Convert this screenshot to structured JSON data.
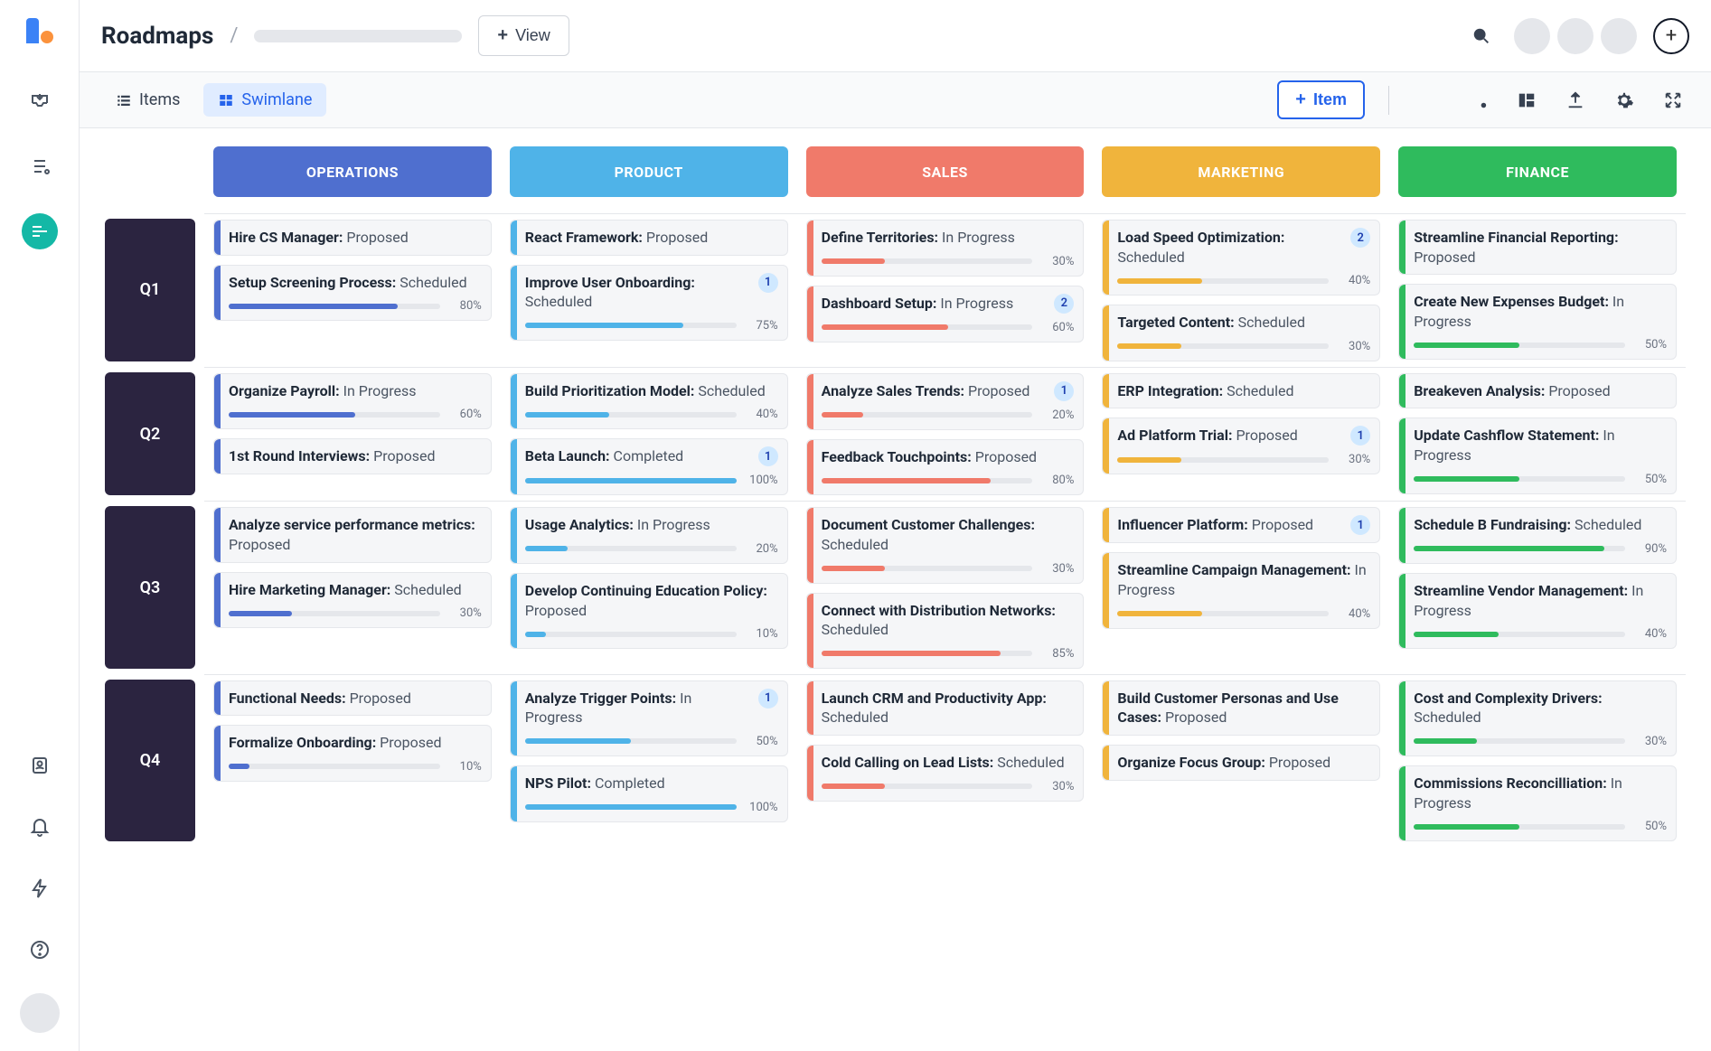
{
  "page_title": "Roadmaps",
  "topbar": {
    "view_button": "View"
  },
  "tabs": {
    "items": "Items",
    "swimlane": "Swimlane"
  },
  "toolbar": {
    "add_item": "Item"
  },
  "columns": [
    {
      "label": "OPERATIONS",
      "color": "#4f6fcf"
    },
    {
      "label": "PRODUCT",
      "color": "#4fb3e8"
    },
    {
      "label": "SALES",
      "color": "#f07a6a"
    },
    {
      "label": "MARKETING",
      "color": "#f0b43c"
    },
    {
      "label": "FINANCE",
      "color": "#2fbb5d"
    }
  ],
  "rows": [
    {
      "label": "Q1",
      "cells": [
        [
          {
            "title": "Hire CS Manager:",
            "status": "Proposed"
          },
          {
            "title": "Setup Screening Process:",
            "status": "Scheduled",
            "progress": 80
          }
        ],
        [
          {
            "title": "React Framework:",
            "status": "Proposed"
          },
          {
            "title": "Improve User Onboarding:",
            "status": "Scheduled",
            "badge": 1,
            "progress": 75
          }
        ],
        [
          {
            "title": "Define Territories:",
            "status": "In Progress",
            "progress": 30
          },
          {
            "title": "Dashboard Setup:",
            "status": "In Progress",
            "badge": 2,
            "progress": 60
          }
        ],
        [
          {
            "title": "Load Speed Optimization:",
            "status": "Scheduled",
            "badge": 2,
            "progress": 40
          },
          {
            "title": "Targeted Content:",
            "status": "Scheduled",
            "progress": 30
          }
        ],
        [
          {
            "title": "Streamline Financial Reporting:",
            "status": "Proposed"
          },
          {
            "title": "Create New Expenses Budget:",
            "status": "In Progress",
            "progress": 50
          }
        ]
      ]
    },
    {
      "label": "Q2",
      "cells": [
        [
          {
            "title": "Organize Payroll:",
            "status": "In Progress",
            "progress": 60
          },
          {
            "title": "1st Round Interviews:",
            "status": "Proposed"
          }
        ],
        [
          {
            "title": "Build Prioritization Model:",
            "status": "Scheduled",
            "progress": 40
          },
          {
            "title": "Beta Launch:",
            "status": "Completed",
            "badge": 1,
            "progress": 100
          }
        ],
        [
          {
            "title": "Analyze Sales Trends:",
            "status": "Proposed",
            "badge": 1,
            "progress": 20
          },
          {
            "title": "Feedback Touchpoints:",
            "status": "Proposed",
            "progress": 80
          }
        ],
        [
          {
            "title": "ERP Integration:",
            "status": "Scheduled"
          },
          {
            "title": "Ad Platform Trial:",
            "status": "Proposed",
            "badge": 1,
            "progress": 30
          }
        ],
        [
          {
            "title": "Breakeven Analysis:",
            "status": "Proposed"
          },
          {
            "title": "Update Cashflow Statement:",
            "status": "In Progress",
            "progress": 50
          }
        ]
      ]
    },
    {
      "label": "Q3",
      "cells": [
        [
          {
            "title": "Analyze service performance metrics:",
            "status": "Proposed"
          },
          {
            "title": "Hire Marketing Manager:",
            "status": "Scheduled",
            "progress": 30
          }
        ],
        [
          {
            "title": "Usage Analytics:",
            "status": "In Progress",
            "progress": 20
          },
          {
            "title": "Develop Continuing Education Policy:",
            "status": "Proposed",
            "progress": 10
          }
        ],
        [
          {
            "title": "Document Customer Challenges:",
            "status": "Scheduled",
            "progress": 30
          },
          {
            "title": "Connect with Distribution Networks:",
            "status": "Scheduled",
            "progress": 85
          }
        ],
        [
          {
            "title": "Influencer Platform:",
            "status": "Proposed",
            "badge": 1
          },
          {
            "title": "Streamline Campaign Management:",
            "status": "In Progress",
            "progress": 40
          }
        ],
        [
          {
            "title": "Schedule B Fundraising:",
            "status": "Scheduled",
            "progress": 90
          },
          {
            "title": "Streamline Vendor Management:",
            "status": "In Progress",
            "progress": 40
          }
        ]
      ]
    },
    {
      "label": "Q4",
      "cells": [
        [
          {
            "title": "Functional Needs:",
            "status": "Proposed"
          },
          {
            "title": "Formalize Onboarding:",
            "status": "Proposed",
            "progress": 10
          }
        ],
        [
          {
            "title": "Analyze Trigger Points:",
            "status": "In Progress",
            "badge": 1,
            "progress": 50
          },
          {
            "title": "NPS Pilot:",
            "status": "Completed",
            "progress": 100
          }
        ],
        [
          {
            "title": "Launch CRM and Productivity App:",
            "status": "Scheduled"
          },
          {
            "title": "Cold Calling on Lead Lists:",
            "status": "Scheduled",
            "progress": 30
          }
        ],
        [
          {
            "title": "Build Customer Personas and Use Cases:",
            "status": "Proposed"
          },
          {
            "title": "Organize Focus Group:",
            "status": "Proposed"
          }
        ],
        [
          {
            "title": "Cost and Complexity Drivers:",
            "status": "Scheduled",
            "progress": 30
          },
          {
            "title": "Commissions Reconcilliation:",
            "status": "In Progress",
            "progress": 50
          }
        ]
      ]
    }
  ]
}
